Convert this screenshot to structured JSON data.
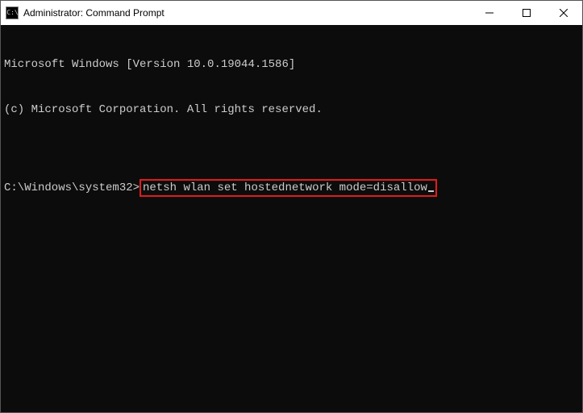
{
  "title_bar": {
    "icon_label": "C:\\",
    "title": "Administrator: Command Prompt"
  },
  "window_controls": {
    "minimize": "minimize",
    "maximize": "maximize",
    "close": "close"
  },
  "terminal": {
    "line1": "Microsoft Windows [Version 10.0.19044.1586]",
    "line2": "(c) Microsoft Corporation. All rights reserved.",
    "blank": "",
    "prompt": "C:\\Windows\\system32>",
    "command": "netsh wlan set hostednetwork mode=disallow"
  },
  "highlight": {
    "color": "#e31b1b"
  }
}
